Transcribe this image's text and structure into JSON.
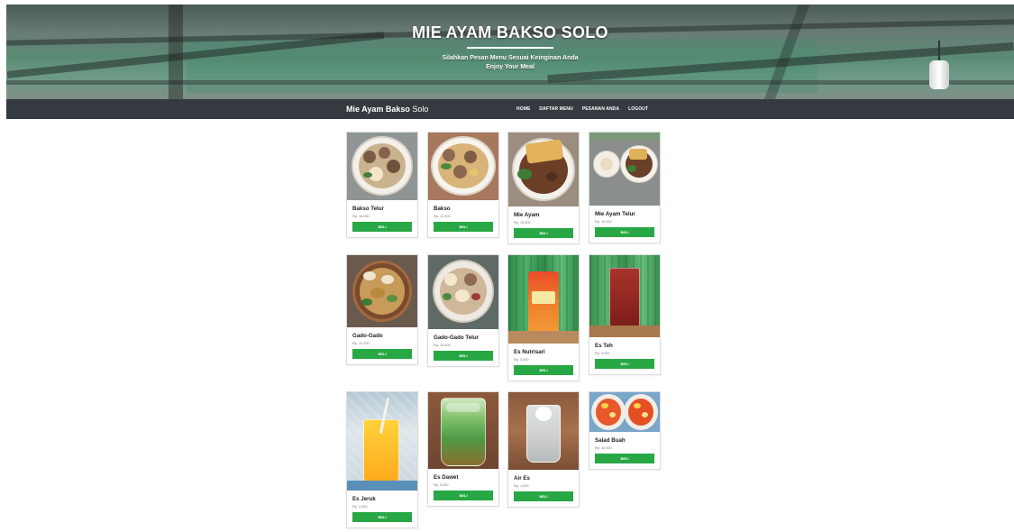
{
  "hero": {
    "title": "MIE AYAM BAKSO SOLO",
    "subtitle_line1": "Silahkan Pesan Menu Sesuai Keinginan Anda",
    "subtitle_line2": "Enjoy Your Meal"
  },
  "navbar": {
    "brand_bold": "Mie Ayam Bakso",
    "brand_rest": " Solo",
    "links": [
      "HOME",
      "DAFTAR MENU",
      "PESANAN ANDA",
      "LOGOUT"
    ]
  },
  "buy_label": "BELI",
  "menu": [
    {
      "name": "Bakso Telur",
      "price": "Rp. 16.000"
    },
    {
      "name": "Bakso",
      "price": "Rp. 12.000"
    },
    {
      "name": "Mie Ayam",
      "price": "Rp. 13.000"
    },
    {
      "name": "Mie Ayam Telur",
      "price": "Rp. 16.000"
    },
    {
      "name": "Gado-Gado",
      "price": "Rp. 12.000"
    },
    {
      "name": "Gado-Gado Telur",
      "price": "Rp. 15.000"
    },
    {
      "name": "Es Nutrisari",
      "price": "Rp. 3.000"
    },
    {
      "name": "Es Teh",
      "price": "Rp. 3.000"
    },
    {
      "name": "Es Jeruk",
      "price": "Rp. 3.000"
    },
    {
      "name": "Es Dawet",
      "price": "Rp. 5.000"
    },
    {
      "name": "Air Es",
      "price": "Rp. 1.000"
    },
    {
      "name": "Salad Buah",
      "price": "Rp. 10.000"
    }
  ],
  "colors": {
    "navbar": "#343a40",
    "buy_button": "#28a745",
    "accent_green": "#28a745"
  }
}
